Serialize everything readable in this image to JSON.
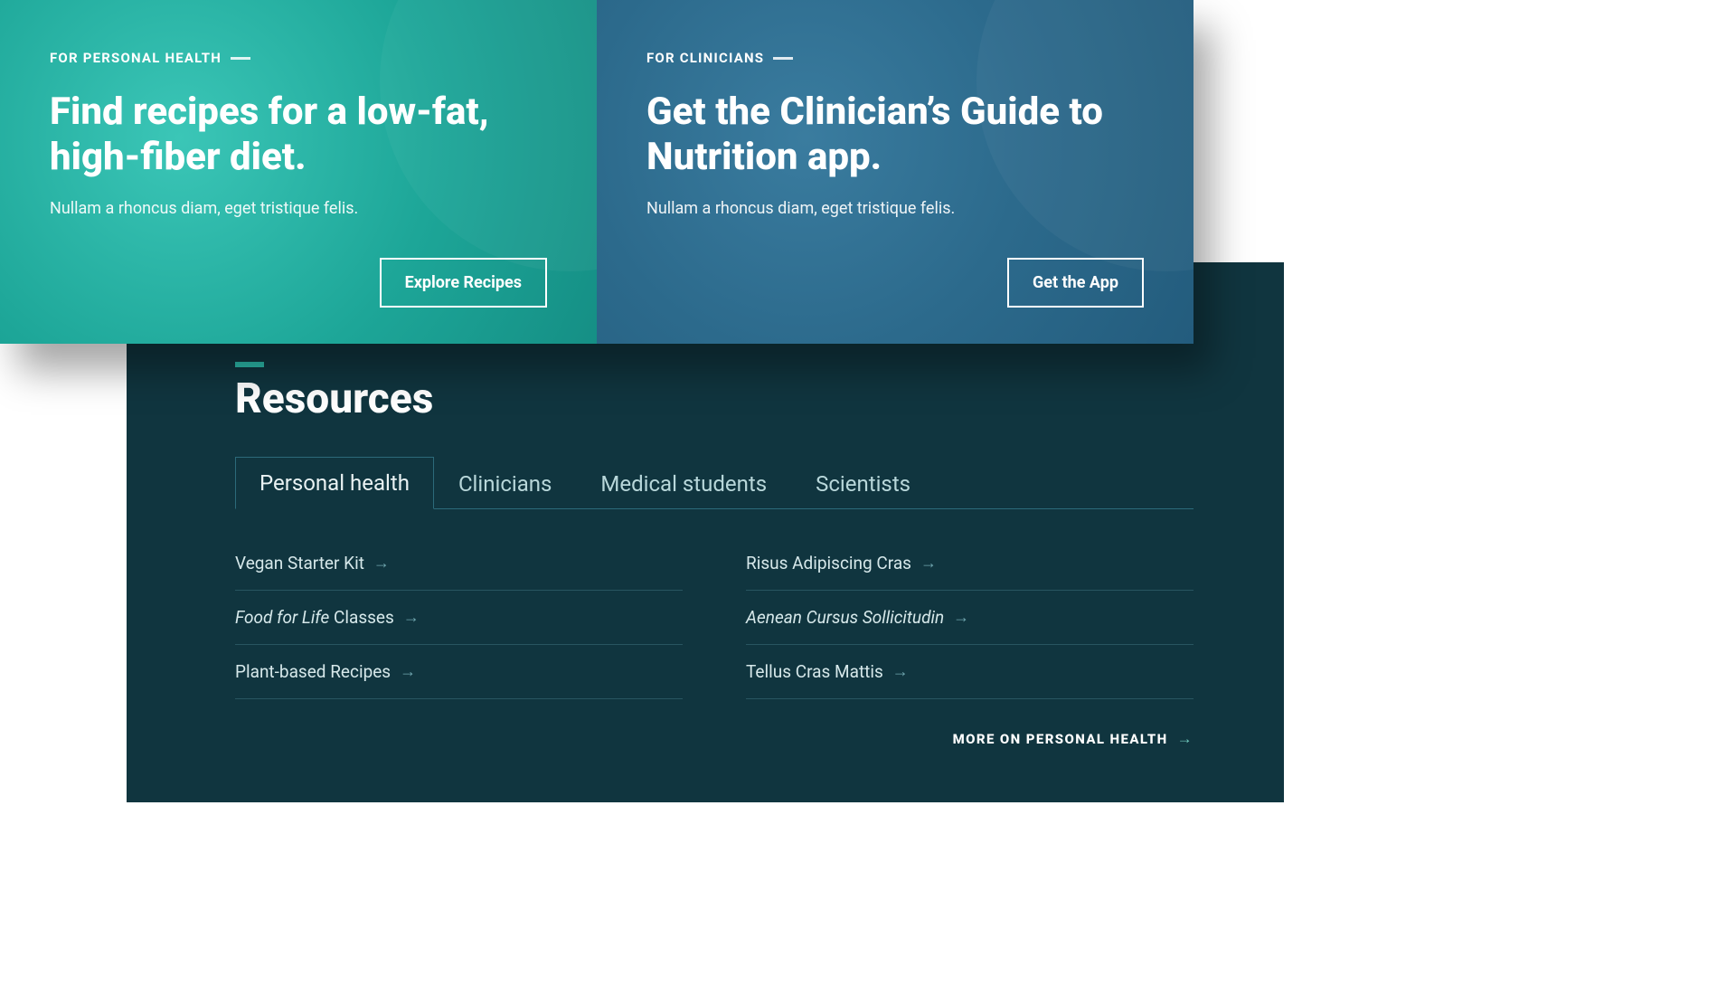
{
  "cards": {
    "left": {
      "eyebrow": "FOR PERSONAL HEALTH",
      "title": "Find recipes for a low-fat, high-fiber diet.",
      "subtitle": "Nullam a rhoncus diam, eget tristique felis.",
      "button": "Explore Recipes"
    },
    "right": {
      "eyebrow": "FOR CLINICIANS",
      "title": "Get the Clinician’s Guide to Nutrition app.",
      "subtitle": "Nullam a rhoncus diam, eget tristique felis.",
      "button": "Get the App"
    }
  },
  "resources": {
    "heading": "Resources",
    "tabs": [
      {
        "label": "Personal health",
        "active": true
      },
      {
        "label": "Clinicians",
        "active": false
      },
      {
        "label": "Medical students",
        "active": false
      },
      {
        "label": "Scientists",
        "active": false
      }
    ],
    "links_col1": [
      {
        "text": "Vegan Starter Kit",
        "italic": false
      },
      {
        "text_pre": "Food for Life",
        "text_post": " Classes",
        "italic": true
      },
      {
        "text": "Plant-based Recipes",
        "italic": false
      }
    ],
    "links_col2": [
      {
        "text": "Risus Adipiscing Cras",
        "italic": false
      },
      {
        "text": "Aenean Cursus Sollicitudin",
        "italic": true
      },
      {
        "text": "Tellus Cras Mattis",
        "italic": false
      }
    ],
    "more": "MORE ON PERSONAL HEALTH"
  }
}
